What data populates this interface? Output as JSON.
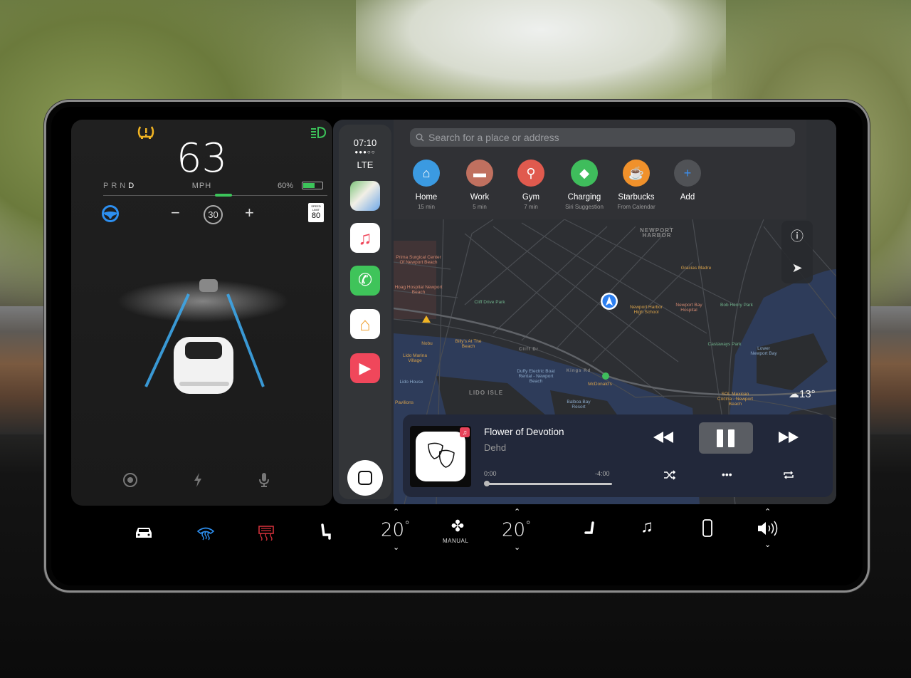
{
  "left_panel": {
    "speed": "63",
    "speed_unit": "MPH",
    "gears": [
      "P",
      "R",
      "N",
      "D"
    ],
    "selected_gear": "D",
    "battery_percent_label": "60%",
    "battery_level": 0.6,
    "set_speed": "30",
    "minus_label": "−",
    "plus_label": "+",
    "speed_limit_label": "SPEED LIMIT",
    "speed_limit_value": "80",
    "tpms_color": "#f0b323",
    "headlight_color": "#3cc45a",
    "autosteer_color": "#2d8ff0"
  },
  "status": {
    "time": "07:10",
    "signal": "●●●○○",
    "network": "LTE"
  },
  "dock": {
    "apps": [
      "maps-icon",
      "music-icon",
      "phone-icon",
      "home-icon",
      "videos-icon"
    ]
  },
  "search": {
    "placeholder": "Search for a place or address"
  },
  "favorites": [
    {
      "name": "Home",
      "sub": "15 min",
      "color": "#3b9ae1",
      "icon": "house-icon",
      "glyph": "⌂"
    },
    {
      "name": "Work",
      "sub": "5 min",
      "color": "#c0705f",
      "icon": "briefcase-icon",
      "glyph": "▬"
    },
    {
      "name": "Gym",
      "sub": "7 min",
      "color": "#e05a4e",
      "icon": "pin-icon",
      "glyph": "⚲"
    },
    {
      "name": "Charging",
      "sub": "Siri Suggestion",
      "color": "#3fbd5c",
      "icon": "leaf-pin-icon",
      "glyph": "◆"
    },
    {
      "name": "Starbucks",
      "sub": "From Calendar",
      "color": "#f0912b",
      "icon": "coffee-icon",
      "glyph": "☕"
    },
    {
      "name": "Add",
      "sub": "",
      "color": "#505256",
      "icon": "plus-icon",
      "glyph": "+"
    }
  ],
  "map": {
    "labels": {
      "newport_harbor": "NEWPORT HARBOR",
      "prima": "Prima Surgical Center Of Newport Beach",
      "hoag": "Hoag Hospital Newport Beach",
      "cliff_drive_park": "Cliff Drive Park",
      "nhhs": "Newport Harbor High School",
      "newport_bay_hospital": "Newport Bay Hospital",
      "bob_henry_park": "Bob Henry Park",
      "gracias_madre": "Gracias Madre",
      "castaways_park": "Castaways Park",
      "lower_newport_bay": "Lower Newport Bay",
      "lido_isle": "LIDO ISLE",
      "lido_marina": "Lido Marina Village",
      "lido_house": "Lido House",
      "billys": "Billy's At The Beach",
      "duffy": "Duffy Electric Boat Rental - Newport Beach",
      "mcdonalds": "McDonald's",
      "balboa": "Balboa Bay Resort",
      "sol": "SOL Mexican Cocina - Newport Beach",
      "nobu": "Nobu",
      "pavilions": "Pavilions",
      "cliff_dr": "Cliff Dr",
      "kings_rd": "Kings Rd"
    },
    "weather": "13°"
  },
  "now_playing": {
    "title": "Flower of Devotion",
    "artist": "Dehd",
    "elapsed": "0:00",
    "remaining": "-4:00",
    "progress": 0.0,
    "badge": "♫"
  },
  "climate": {
    "driver_temp": "20",
    "passenger_temp": "20",
    "degree": "°",
    "fan_mode": "MANUAL",
    "front_defrost_color": "#2d8ff0",
    "rear_defrost_color": "#d0303a"
  }
}
